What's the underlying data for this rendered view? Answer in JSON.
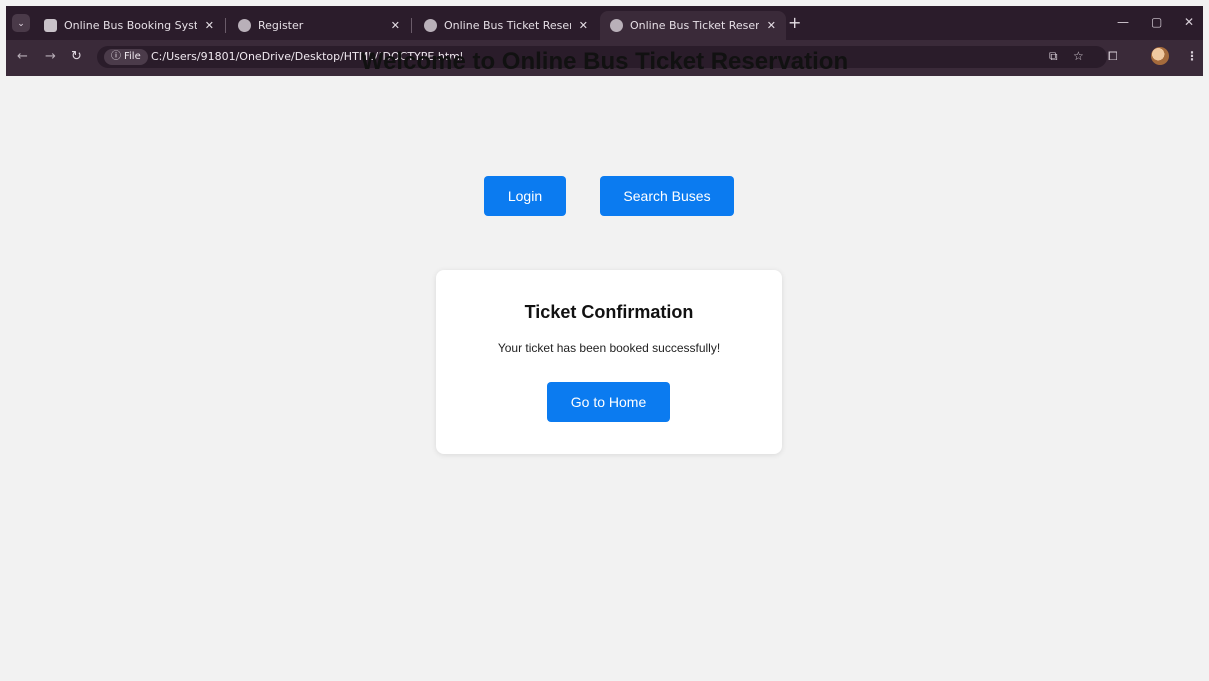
{
  "browser": {
    "tabs": [
      {
        "title": "Online Bus Booking System",
        "close": "✕"
      },
      {
        "title": "Register",
        "close": "✕"
      },
      {
        "title": "Online Bus Ticket Reservation",
        "close": "✕"
      },
      {
        "title": "Online Bus Ticket Reservation",
        "close": "✕"
      }
    ],
    "active_tab": 3,
    "new_tab": "+",
    "address": {
      "chip": "File",
      "url": "C:/Users/91801/OneDrive/Desktop/HTML/!DOCTYPE.html"
    },
    "icons": [
      "tab-search-icon",
      "back-icon",
      "forward-icon",
      "reload-icon",
      "info-icon",
      "translate-icon",
      "star-icon",
      "extensions-icon",
      "profile-avatar-icon",
      "menu-icon",
      "minimize-icon",
      "restore-icon",
      "close-window-icon"
    ]
  },
  "page": {
    "heading": "Welcome to Online Bus Ticket Reservation",
    "nav": {
      "login": "Login",
      "search": "Search Buses"
    },
    "card": {
      "title": "Ticket Confirmation",
      "message": "Your ticket has been booked successfully!",
      "home_button": "Go to Home"
    }
  },
  "colors": {
    "accent": "#0b7bf0",
    "chrome": "#2b1c2b",
    "page_bg": "#f2f2f2"
  }
}
